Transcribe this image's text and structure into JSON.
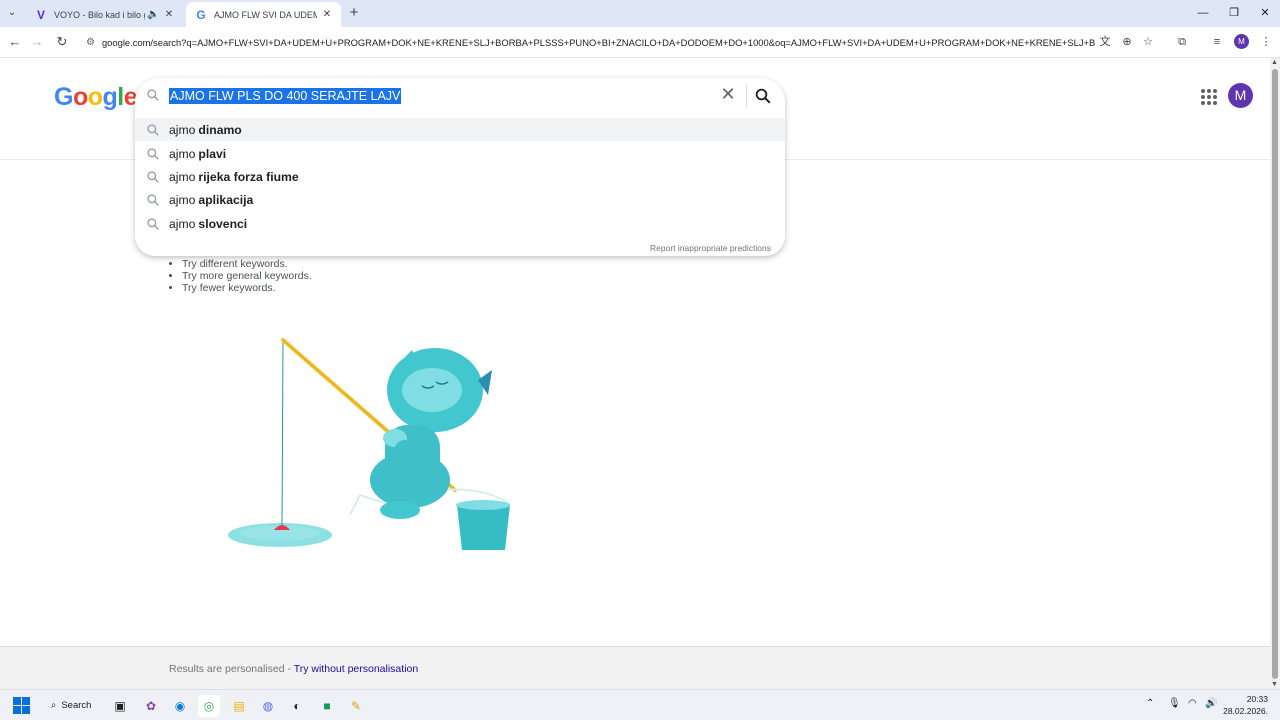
{
  "browser": {
    "tabs": [
      {
        "title": "VOYO - Bilo kad i bilo gdje",
        "icon": "voyo-icon",
        "active": false,
        "audio": true
      },
      {
        "title": "AJMO FLW SVI DA UDEM U PR",
        "icon": "google-icon",
        "active": true,
        "audio": false
      }
    ],
    "new_tab": "+",
    "url": "google.com/search?q=AJMO+FLW+SVI+DA+UDEM+U+PROGRAM+DOK+NE+KRENE+SLJ+BORBA+PLSSS+PUNO+BI+ZNACILO+DA+DODOEM+DO+1000&oq=AJMO+FLW+SVI+DA+UDEM+U+PROGRAM+DOK+NE+KRENE+SLJ+BORB...",
    "profile_initial": "M"
  },
  "google": {
    "logo_letters": [
      "G",
      "o",
      "o",
      "g",
      "l",
      "e"
    ],
    "avatar_initial": "M",
    "search_query": "AJMO FLW PLS DO 400 SERAJTE LAJV",
    "suggestions": [
      {
        "prefix": "ajmo",
        "bold": "dinamo"
      },
      {
        "prefix": "ajmo",
        "bold": "plavi"
      },
      {
        "prefix": "ajmo",
        "bold": "rijeka forza fiume"
      },
      {
        "prefix": "ajmo",
        "bold": "aplikacija"
      },
      {
        "prefix": "ajmo",
        "bold": "slovenci"
      }
    ],
    "report_link": "Report inappropriate predictions",
    "tips": [
      "Try different keywords.",
      "Try more general keywords.",
      "Try fewer keywords."
    ],
    "footer": {
      "text": "Results are personalised - ",
      "link": "Try without personalisation"
    }
  },
  "taskbar": {
    "search_label": "Search",
    "time": "20:33",
    "date": "28.02.2026."
  },
  "colors": {
    "selection": "#1a73e8",
    "avatar": "#5e35b1",
    "link": "#1a0dab"
  }
}
